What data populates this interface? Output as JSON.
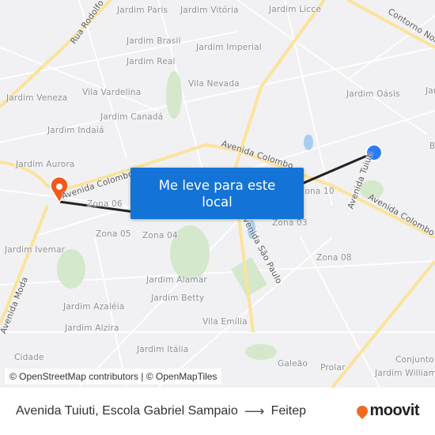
{
  "map": {
    "labels": [
      "Jardim Paris",
      "Jardim Vitória",
      "Jardim Licce",
      "Jardim Brasil",
      "Jardim Imperial",
      "Jardim Real",
      "Vila Nevada",
      "Vila Vardelina",
      "Jardim Veneza",
      "Jardim Oásis",
      "Jar",
      "Jardim Canadá",
      "Jardim Indaiá",
      "Jardim Aurora",
      "B",
      "Zona 10",
      "Zona 06",
      "Zona 03",
      "Zona 05",
      "Zona 04",
      "Zona 08",
      "Jardim Ivemar",
      "Jardim Alamar",
      "Jardim Betty",
      "Jardim Azaléia",
      "Jardim Alzira",
      "Vila Emília",
      "Jardim Itália",
      "Cidade",
      "Galeão",
      "Prolar",
      "Conjunto",
      "Jardim William"
    ],
    "roads": [
      "Rua Rodolfo",
      "Contorno Norte",
      "Avenida Colombo",
      "Avenida Colombo",
      "Avenida Colombo",
      "Avenida Tuiuti",
      "Avenida São Paulo",
      "Avenida Moda"
    ],
    "origin_color": "#2d7cf6",
    "destination_color": "#f2591c",
    "route_color": "#222222"
  },
  "cta": {
    "label": "Me leve para este local"
  },
  "attribution": "© OpenStreetMap contributors | © OpenMapTiles",
  "footer": {
    "origin": "Avenida Tuiuti, Escola Gabriel Sampaio",
    "arrow": "⟶",
    "destination": "Feitep"
  },
  "brand": {
    "name": "moovit",
    "color": "#f26a21"
  }
}
